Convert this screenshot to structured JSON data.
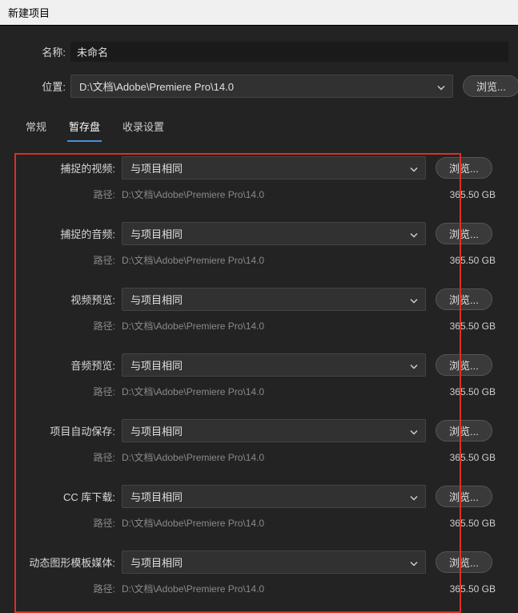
{
  "window": {
    "title": "新建项目"
  },
  "top": {
    "name_label": "名称:",
    "name_value": "未命名",
    "location_label": "位置:",
    "location_value": "D:\\文档\\Adobe\\Premiere Pro\\14.0",
    "browse": "浏览..."
  },
  "tabs": {
    "general": "常规",
    "scratch": "暂存盘",
    "ingest": "收录设置"
  },
  "scratch": {
    "same_as_project": "与项目相同",
    "path_label": "路径:",
    "path_value": "D:\\文档\\Adobe\\Premiere Pro\\14.0",
    "size": "365.50 GB",
    "browse": "浏览...",
    "items": [
      {
        "label": "捕捉的视频:"
      },
      {
        "label": "捕捉的音频:"
      },
      {
        "label": "视频预览:"
      },
      {
        "label": "音频预览:"
      },
      {
        "label": "项目自动保存:"
      },
      {
        "label": "CC 库下载:"
      },
      {
        "label": "动态图形模板媒体:"
      }
    ]
  }
}
